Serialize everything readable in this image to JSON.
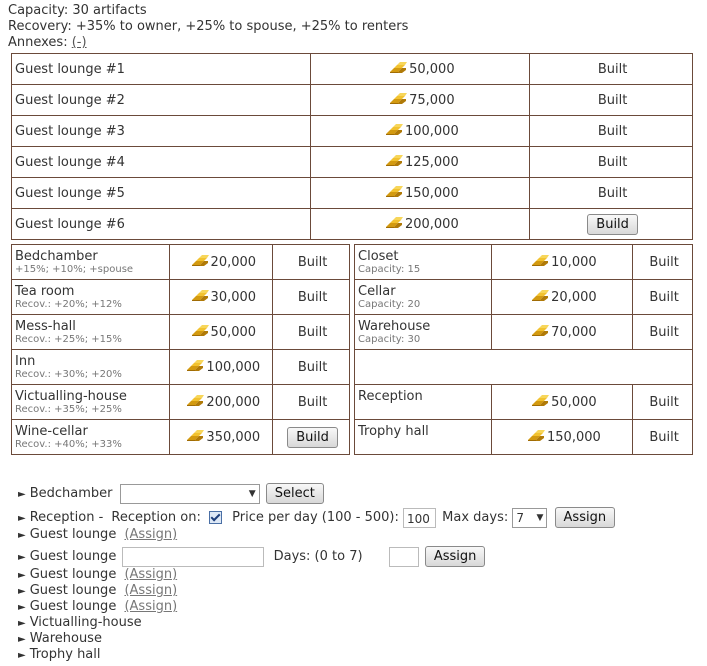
{
  "info": {
    "capacity": "Capacity: 30 artifacts",
    "recovery": "Recovery: +35% to owner, +25% to spouse, +25% to renters",
    "annexes_label": "Annexes:",
    "annexes_link": "(-)"
  },
  "guest_lounges": [
    {
      "name": "Guest lounge #1",
      "cost": "50,000",
      "status": "Built",
      "is_button": false
    },
    {
      "name": "Guest lounge #2",
      "cost": "75,000",
      "status": "Built",
      "is_button": false
    },
    {
      "name": "Guest lounge #3",
      "cost": "100,000",
      "status": "Built",
      "is_button": false
    },
    {
      "name": "Guest lounge #4",
      "cost": "125,000",
      "status": "Built",
      "is_button": false
    },
    {
      "name": "Guest lounge #5",
      "cost": "150,000",
      "status": "Built",
      "is_button": false
    },
    {
      "name": "Guest lounge #6",
      "cost": "200,000",
      "status": "Build",
      "is_button": true
    }
  ],
  "left_rooms": [
    {
      "name": "Bedchamber",
      "sub": "+15%; +10%; +spouse",
      "cost": "20,000",
      "status": "Built",
      "is_button": false
    },
    {
      "name": "Tea room",
      "sub": "Recov.: +20%; +12%",
      "cost": "30,000",
      "status": "Built",
      "is_button": false
    },
    {
      "name": "Mess-hall",
      "sub": "Recov.: +25%; +15%",
      "cost": "50,000",
      "status": "Built",
      "is_button": false
    },
    {
      "name": "Inn",
      "sub": "Recov.: +30%; +20%",
      "cost": "100,000",
      "status": "Built",
      "is_button": false
    },
    {
      "name": "Victualling-house",
      "sub": "Recov.: +35%; +25%",
      "cost": "200,000",
      "status": "Built",
      "is_button": false
    },
    {
      "name": "Wine-cellar",
      "sub": "Recov.: +40%; +33%",
      "cost": "350,000",
      "status": "Build",
      "is_button": true
    }
  ],
  "right_rooms": [
    {
      "name": "Closet",
      "sub": "Capacity: 15",
      "cost": "10,000",
      "status": "Built",
      "is_button": false
    },
    {
      "name": "Cellar",
      "sub": "Capacity: 20",
      "cost": "20,000",
      "status": "Built",
      "is_button": false
    },
    {
      "name": "Warehouse",
      "sub": "Capacity: 30",
      "cost": "70,000",
      "status": "Built",
      "is_button": false
    },
    {
      "name": "",
      "sub": "",
      "cost": "",
      "status": "",
      "is_button": false,
      "empty": true
    },
    {
      "name": "Reception",
      "sub": "",
      "cost": "50,000",
      "status": "Built",
      "is_button": false
    },
    {
      "name": "Trophy hall",
      "sub": "",
      "cost": "150,000",
      "status": "Built",
      "is_button": false
    }
  ],
  "actions": {
    "bedchamber": {
      "label": "Bedchamber",
      "select_button": "Select"
    },
    "reception": {
      "label": "Reception -",
      "reception_on_label": "Reception on:",
      "price_label": "Price per day (100 - 500):",
      "price_value": "100",
      "max_days_label": "Max days:",
      "max_days_value": "7",
      "assign_button": "Assign"
    },
    "lounge_a": {
      "label": "Guest lounge",
      "link": "(Assign)"
    },
    "lounge_b": {
      "label": "Guest lounge",
      "days_label": "Days: (0 to 7)",
      "assign_button": "Assign"
    },
    "lounge_c": {
      "label": "Guest lounge",
      "link": "(Assign)"
    },
    "lounge_d": {
      "label": "Guest lounge",
      "link": "(Assign)"
    },
    "lounge_e": {
      "label": "Guest lounge",
      "link": "(Assign)"
    },
    "victualling": {
      "label": "Victualling-house"
    },
    "warehouse": {
      "label": "Warehouse"
    },
    "trophy": {
      "label": "Trophy hall"
    }
  },
  "colors": {
    "border": "#6b4a3a",
    "gold": "#e0b020"
  }
}
